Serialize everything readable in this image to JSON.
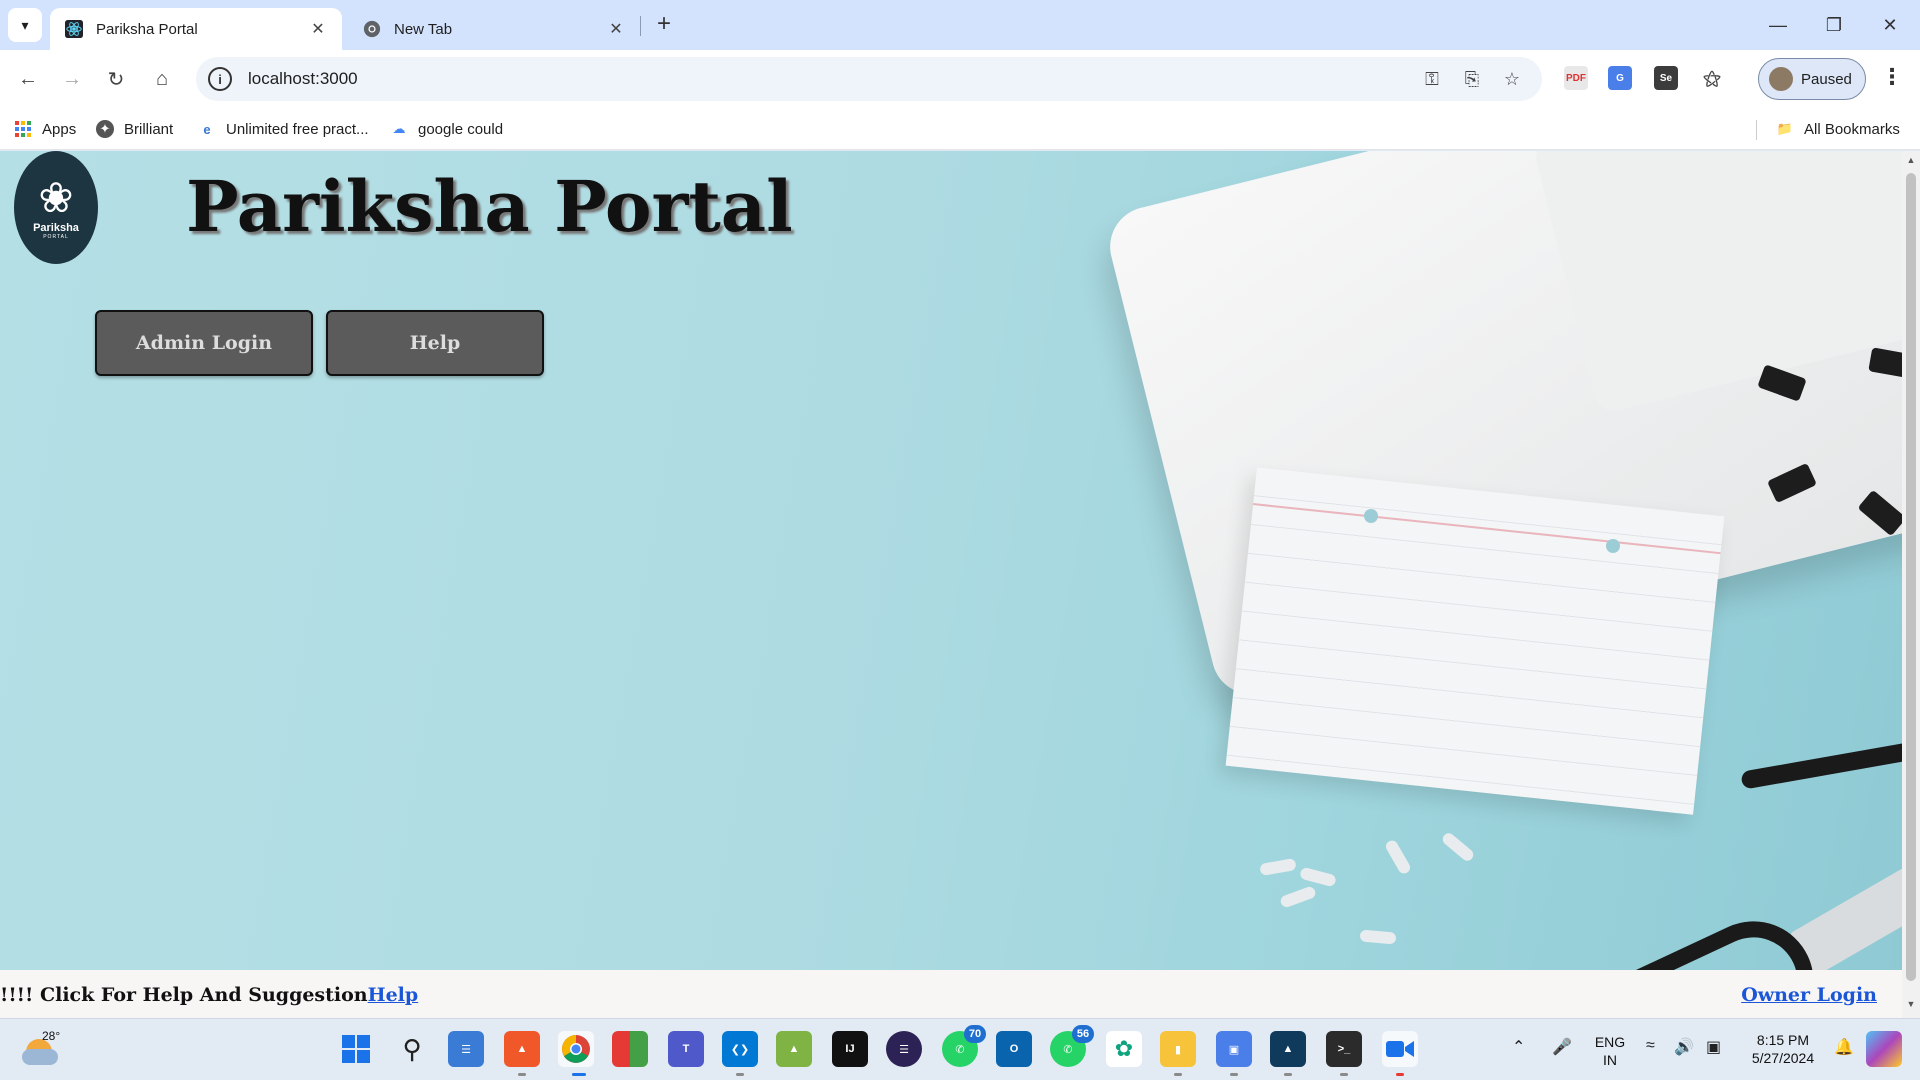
{
  "browser": {
    "tabs": [
      {
        "title": "Pariksha Portal",
        "active": true
      },
      {
        "title": "New Tab",
        "active": false
      }
    ],
    "url": "localhost:3000",
    "profile_label": "Paused",
    "bookmarks": [
      {
        "label": "Apps",
        "icon": "apps-grid-icon"
      },
      {
        "label": "Brilliant",
        "icon": "brilliant-icon"
      },
      {
        "label": "Unlimited free pract...",
        "icon": "practice-icon"
      },
      {
        "label": "google could",
        "icon": "google-cloud-icon"
      }
    ],
    "all_bookmarks_label": "All Bookmarks"
  },
  "page": {
    "logo": {
      "name": "Pariksha",
      "sub": "PORTAL"
    },
    "title": "Pariksha Portal",
    "buttons": {
      "admin_login": "Admin Login",
      "help": "Help"
    },
    "footer": {
      "text": "!!!! Click For Help And Suggestion",
      "help_link": "Help",
      "owner_login": "Owner Login"
    }
  },
  "taskbar": {
    "weather_temp": "28°",
    "badges": {
      "whatsapp": "70",
      "whatsapp2": "56"
    },
    "language": {
      "line1": "ENG",
      "line2": "IN"
    },
    "time": "8:15 PM",
    "date": "5/27/2024"
  },
  "colors": {
    "tabstrip": "#d3e3fd",
    "hero": "#b4dfe5",
    "button": "#5b5b5b",
    "link": "#1a56d6"
  }
}
